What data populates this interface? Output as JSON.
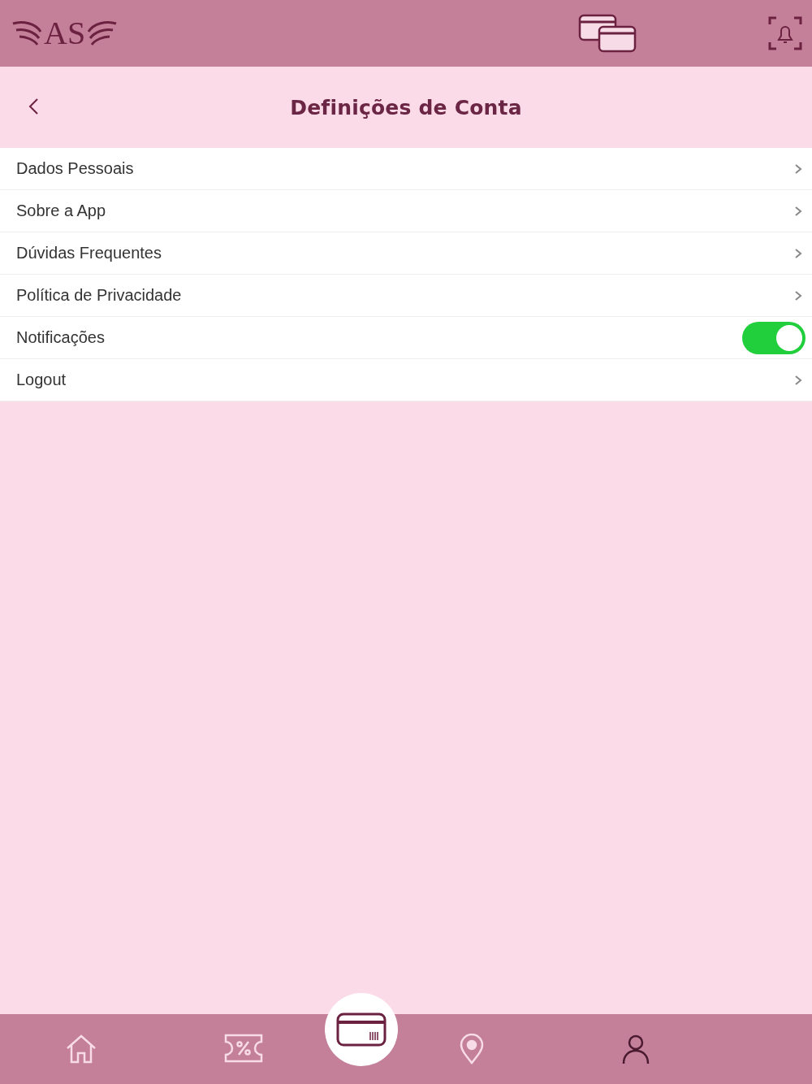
{
  "header": {
    "logo": "AS"
  },
  "page": {
    "title": "Definições de Conta"
  },
  "menu": [
    {
      "kind": "link",
      "label": "Dados Pessoais"
    },
    {
      "kind": "link",
      "label": "Sobre a App"
    },
    {
      "kind": "link",
      "label": "Dúvidas Frequentes"
    },
    {
      "kind": "link",
      "label": "Política de Privacidade"
    },
    {
      "kind": "toggle",
      "label": "Notificações",
      "on": true
    },
    {
      "kind": "link",
      "label": "Logout"
    }
  ],
  "bottom_nav": [
    {
      "selected": false
    },
    {
      "selected": false
    },
    {
      "selected": false
    },
    {
      "selected": true
    }
  ]
}
